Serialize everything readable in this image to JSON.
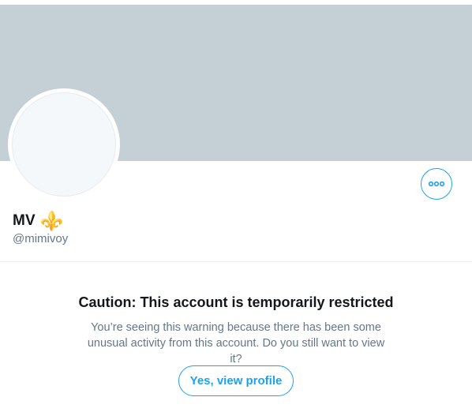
{
  "profile": {
    "display_name": "MV",
    "name_emoji": "⚜️",
    "handle": "@mimivoy",
    "more_icon": "more-dots-icon"
  },
  "warning": {
    "title": "Caution: This account is temporarily restricted",
    "text": "You’re seeing this warning because there has been some unusual activity from this account. Do you still want to view it?",
    "button_label": "Yes, view profile"
  },
  "colors": {
    "accent": "#1da1f2",
    "banner": "#c4cfd6",
    "secondary_text": "#657786",
    "primary_text": "#14171a",
    "divider": "#e6ecf0",
    "emoji": "#7e57c2"
  }
}
